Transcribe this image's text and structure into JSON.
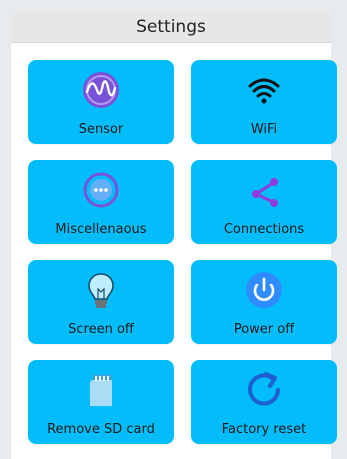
{
  "header": {
    "title": "Settings"
  },
  "tiles": [
    {
      "label": "Sensor",
      "icon": "sensor-icon"
    },
    {
      "label": "WiFi",
      "icon": "wifi-icon"
    },
    {
      "label": "Miscellenaous",
      "icon": "miscellaneous-icon"
    },
    {
      "label": "Connections",
      "icon": "connections-icon"
    },
    {
      "label": "Screen off",
      "icon": "lightbulb-icon"
    },
    {
      "label": "Power off",
      "icon": "power-icon"
    },
    {
      "label": "Remove SD card",
      "icon": "sd-card-icon"
    },
    {
      "label": "Factory reset",
      "icon": "reset-icon"
    }
  ],
  "colors": {
    "tile": "#02bdf9",
    "background": "#e8ebee",
    "title_bar": "#e7e7e7",
    "accent_purple": "#7a52d8",
    "accent_blue": "#2f8cff"
  }
}
